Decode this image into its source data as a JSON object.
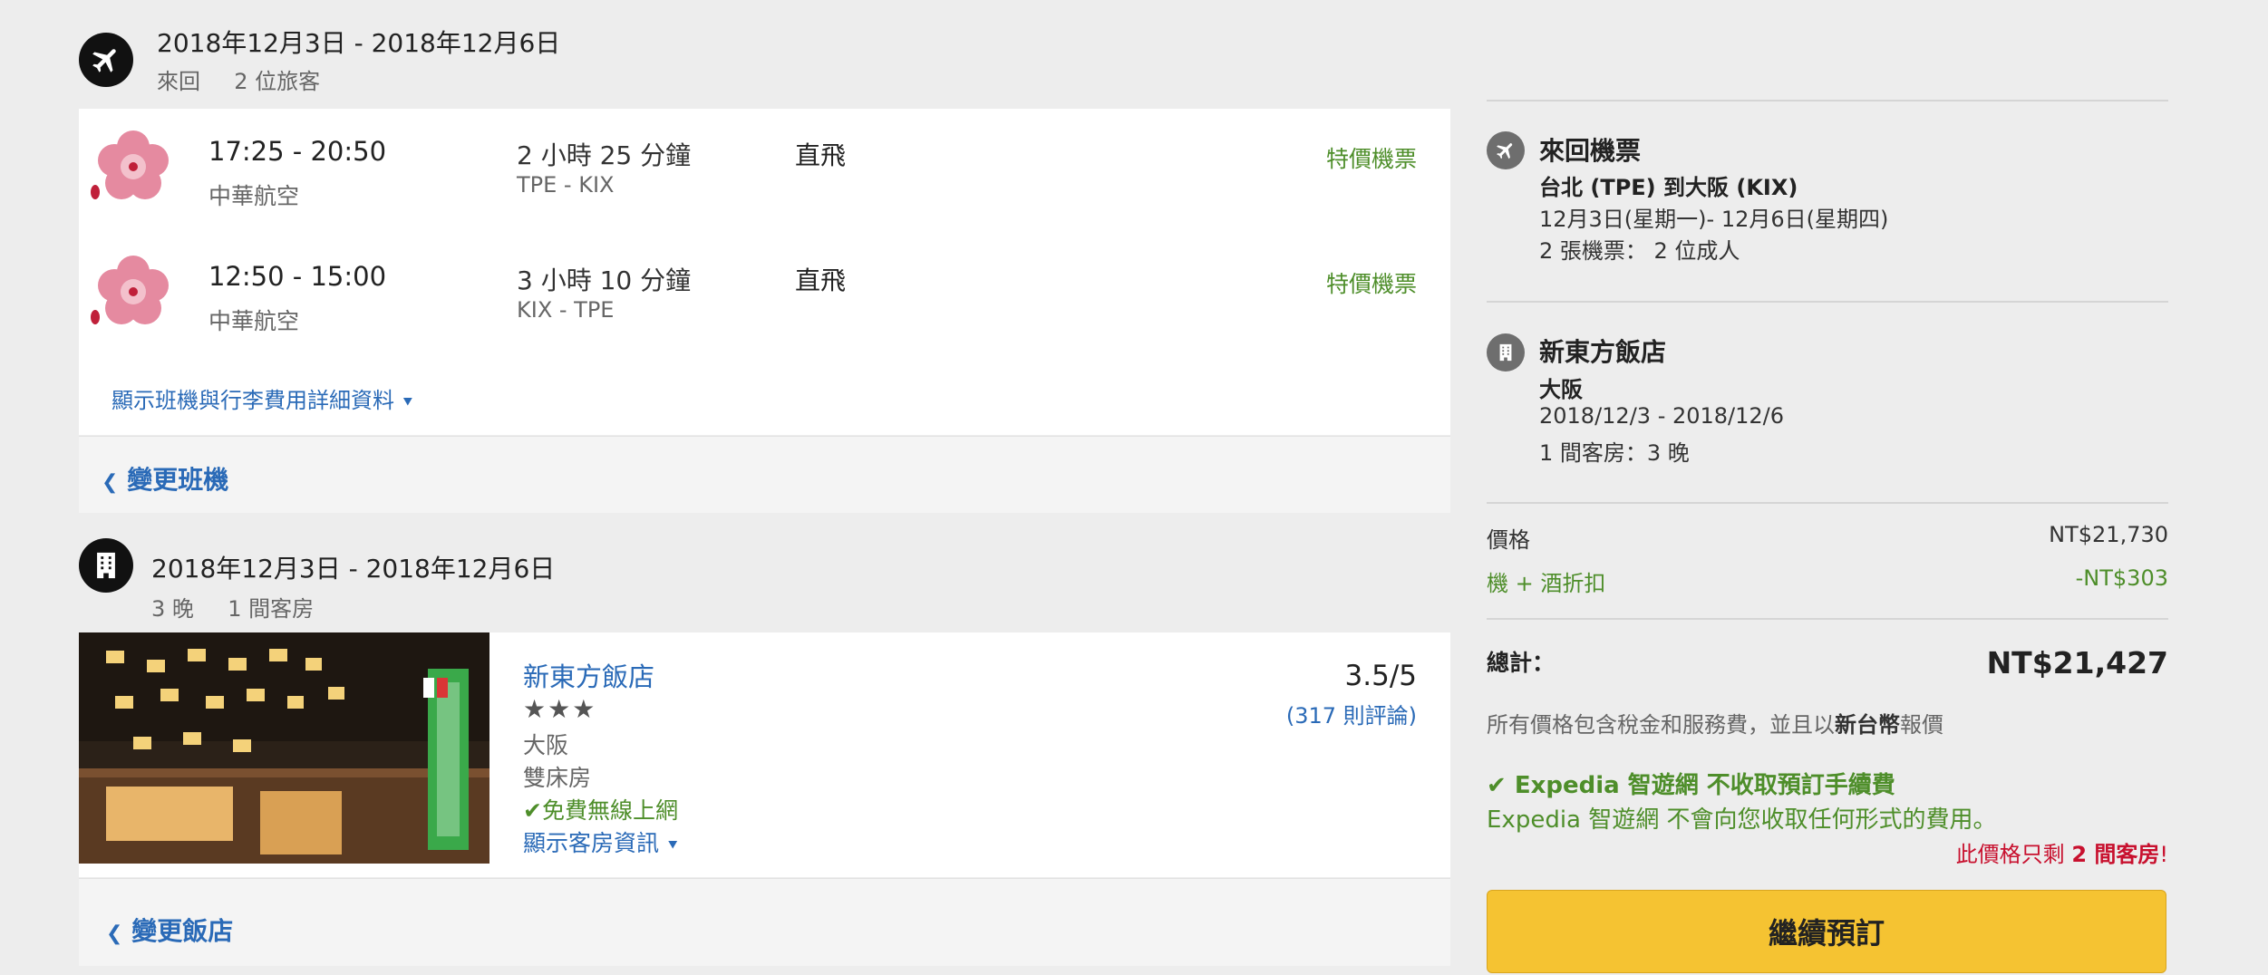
{
  "flight_section": {
    "dates": "2018年12月3日 - 2018年12月6日",
    "trip_type": "來回",
    "travelers": "2 位旅客",
    "legs": [
      {
        "time": "17:25 - 20:50",
        "airline": "中華航空",
        "duration": "2 小時 25 分鐘",
        "route": "TPE - KIX",
        "stops": "直飛",
        "deal": "特價機票"
      },
      {
        "time": "12:50 - 15:00",
        "airline": "中華航空",
        "duration": "3 小時 10 分鐘",
        "route": "KIX - TPE",
        "stops": "直飛",
        "deal": "特價機票"
      }
    ],
    "details_link": "顯示班機與行李費用詳細資料",
    "change_link": "變更班機"
  },
  "hotel_section": {
    "dates": "2018年12月3日 - 2018年12月6日",
    "nights": "3 晚",
    "rooms": "1 間客房",
    "name": "新東方飯店",
    "stars": "★★★",
    "city": "大阪",
    "room_type": "雙床房",
    "amenity": "免費無線上網",
    "room_info_link": "顯示客房資訊",
    "rating": "3.5/5",
    "reviews": "(317 則評論)",
    "change_link": "變更飯店"
  },
  "summary": {
    "flight": {
      "title": "來回機票",
      "route": "台北 (TPE) 到大阪 (KIX)",
      "dates": "12月3日(星期一)- 12月6日(星期四)",
      "tickets": "2 張機票： 2 位成人"
    },
    "hotel": {
      "title": "新東方飯店",
      "city": "大阪",
      "dates": "2018/12/3 - 2018/12/6",
      "rooms": "1 間客房：3 晚"
    },
    "price_label": "價格",
    "price_value": "NT$21,730",
    "discount_label": "機 + 酒折扣",
    "discount_value": "-NT$303",
    "total_label": "總計：",
    "total_value": "NT$21,427",
    "tax_note_prefix": "所有價格包含稅金和服務費，並且以",
    "tax_note_currency": "新台幣",
    "tax_note_suffix": "報價",
    "no_fee_title": "Expedia 智遊網 不收取預訂手續費",
    "no_fee_body": "Expedia 智遊網 不會向您收取任何形式的費用。",
    "scarcity_prefix": "此價格只剩 ",
    "scarcity_count": "2 間客房",
    "scarcity_suffix": "!",
    "continue_button": "繼續預訂"
  },
  "colors": {
    "link": "#2a6ab7",
    "green": "#4e8e2a",
    "red": "#c8102e",
    "button": "#f5c332"
  },
  "icons": {
    "flight": "airplane-icon",
    "hotel": "building-icon",
    "airline": "plum-blossom-logo"
  }
}
